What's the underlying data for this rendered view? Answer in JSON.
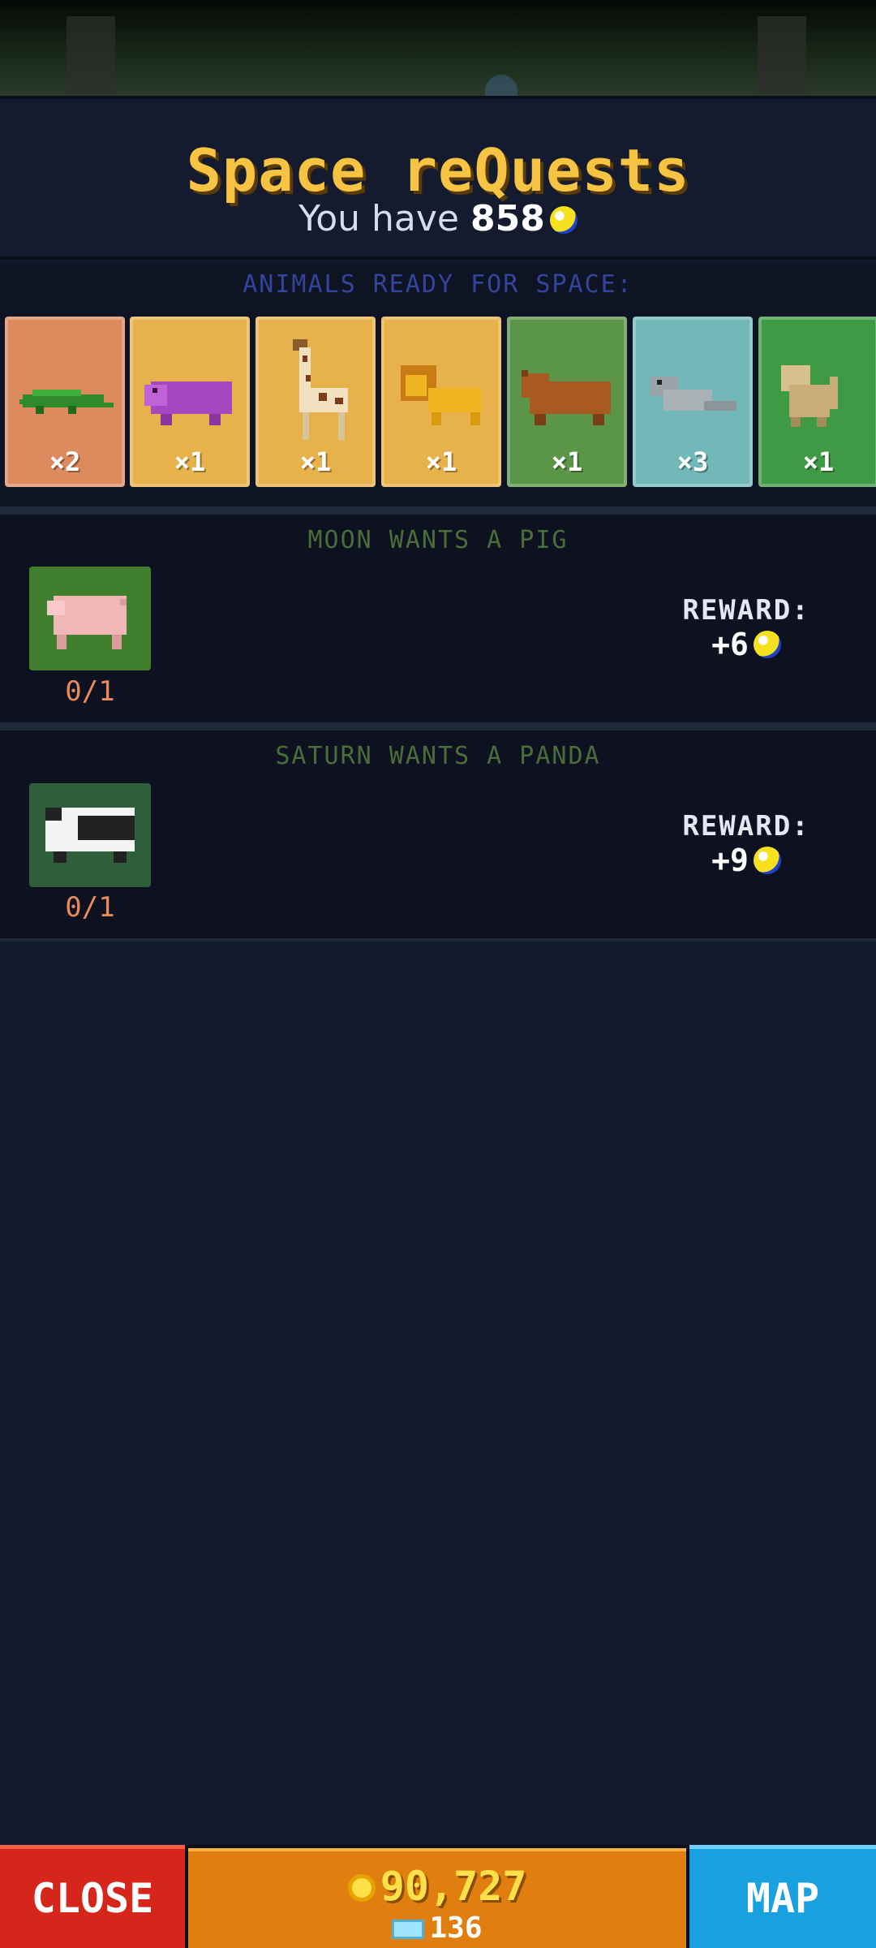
{
  "header": {
    "title": "Space reQuests",
    "you_have_prefix": "You have",
    "moon_balance": "858"
  },
  "animals_section": {
    "heading": "ANIMALS READY FOR SPACE:",
    "cards": [
      {
        "animal": "crocodile",
        "count": "×2",
        "color": "#dd8a5f"
      },
      {
        "animal": "hippo",
        "count": "×1",
        "color": "#e7b24b"
      },
      {
        "animal": "giraffe",
        "count": "×1",
        "color": "#e7b24b"
      },
      {
        "animal": "lion",
        "count": "×1",
        "color": "#e7b24b"
      },
      {
        "animal": "bear",
        "count": "×1",
        "color": "#5a9548"
      },
      {
        "animal": "seal",
        "count": "×3",
        "color": "#72b8b8"
      },
      {
        "animal": "monkey",
        "count": "×1",
        "color": "#3f9a46"
      }
    ]
  },
  "requests": [
    {
      "heading": "MOON WANTS A PIG",
      "animal": "pig",
      "progress": "0/1",
      "reward_label": "REWARD:",
      "reward_value": "+6",
      "tile_color": "#3f7f2e"
    },
    {
      "heading": "SATURN WANTS A PANDA",
      "animal": "panda",
      "progress": "0/1",
      "reward_label": "REWARD:",
      "reward_value": "+9",
      "tile_color": "#2f5f3a"
    }
  ],
  "bottom_bar": {
    "close_label": "CLOSE",
    "coins": "90,727",
    "gems": "136",
    "map_label": "MAP"
  }
}
